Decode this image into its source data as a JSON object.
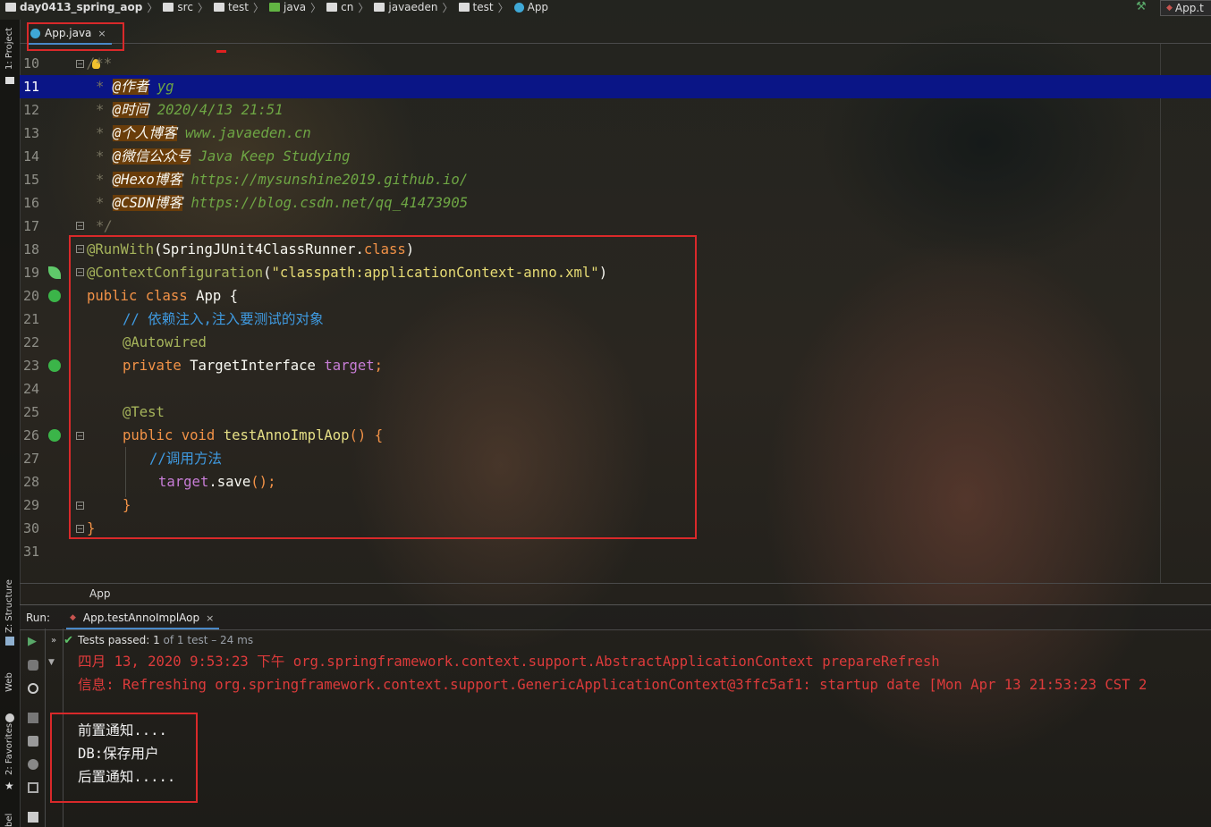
{
  "breadcrumb": [
    "day0413_spring_aop",
    "src",
    "test",
    "java",
    "cn",
    "javaeden",
    "test",
    "App"
  ],
  "run_config_label": "App.t",
  "side_tools": {
    "project": "1: Project",
    "structure": "Z: Structure",
    "web": "Web",
    "favorites": "2: Favorites",
    "label_cut": "bel"
  },
  "editor": {
    "tab_label": "App.java",
    "tab_close": "×",
    "line_numbers": [
      "10",
      "11",
      "12",
      "13",
      "14",
      "15",
      "16",
      "17",
      "18",
      "19",
      "20",
      "21",
      "22",
      "23",
      "24",
      "25",
      "26",
      "27",
      "28",
      "29",
      "30",
      "31"
    ],
    "doc": {
      "open": "/**",
      "star": "*",
      "close": "*/",
      "author_tag": "@作者",
      "author_val": "yg",
      "time_tag": "@时间",
      "time_val": "2020/4/13 21:51",
      "blog_tag": "@个人博客",
      "blog_val": "www.javaeden.cn",
      "wechat_tag": "@微信公众号",
      "wechat_val": "Java Keep Studying",
      "hexo_tag": "@Hexo博客",
      "hexo_val": "https://mysunshine2019.github.io/",
      "csdn_tag": "@CSDN博客",
      "csdn_val": "https://blog.csdn.net/qq_41473905"
    },
    "code": {
      "runwith": "@RunWith",
      "runwith_arg": "SpringJUnit4ClassRunner",
      "dot": ".",
      "class_kw": "class",
      "lp": "(",
      "rp": ")",
      "ctxconf": "@ContextConfiguration",
      "ctxconf_arg": "\"classpath:applicationContext-anno.xml\"",
      "public_kw": "public",
      "class_name": "App",
      "lbrace": "{",
      "rbrace": "}",
      "comment1": "// 依赖注入,注入要测试的对象",
      "autowired": "@Autowired",
      "private_kw": "private",
      "field_type": "TargetInterface",
      "field_name": "target",
      "semi": ";",
      "test_ann": "@Test",
      "void_kw": "void",
      "method_name": "testAnnoImplAop",
      "parens": "()",
      "comment2": "//调用方法",
      "call_target": "target",
      "call_method": "save"
    },
    "bottom_breadcrumb": "App"
  },
  "run_panel": {
    "label": "Run:",
    "tab_label": "App.testAnnoImplAop",
    "tab_close": "×",
    "status_passed": "Tests passed:",
    "status_count": "1",
    "status_rest": "of 1 test – 24 ms",
    "log_line1": "四月 13, 2020 9:53:23 下午 org.springframework.context.support.AbstractApplicationContext prepareRefresh",
    "log_line2": "信息: Refreshing org.springframework.context.support.GenericApplicationContext@3ffc5af1: startup date [Mon Apr 13 21:53:23 CST 2",
    "output": [
      "前置通知....",
      "DB:保存用户",
      "后置通知....."
    ]
  }
}
